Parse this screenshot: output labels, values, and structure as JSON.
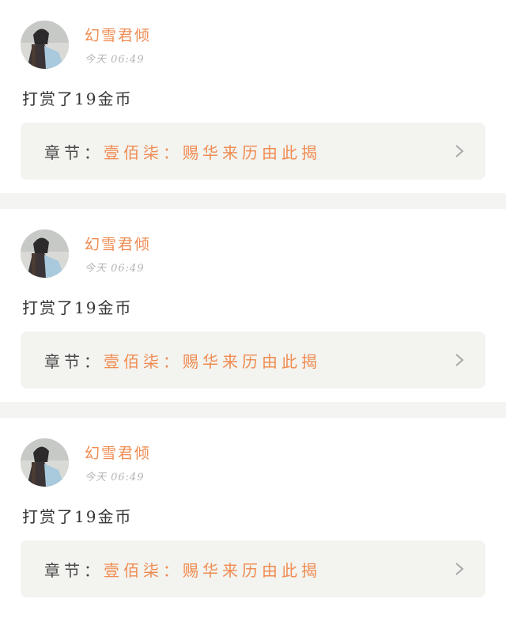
{
  "feed": [
    {
      "username": "幻雪君倾",
      "timestamp": "今天 06:49",
      "message": "打赏了19金币",
      "chapter_prefix": "章节：",
      "chapter_title": "壹佰柒：赐华来历由此揭"
    },
    {
      "username": "幻雪君倾",
      "timestamp": "今天 06:49",
      "message": "打赏了19金币",
      "chapter_prefix": "章节：",
      "chapter_title": "壹佰柒：赐华来历由此揭"
    },
    {
      "username": "幻雪君倾",
      "timestamp": "今天 06:49",
      "message": "打赏了19金币",
      "chapter_prefix": "章节：",
      "chapter_title": "壹佰柒：赐华来历由此揭"
    }
  ],
  "colors": {
    "accent": "#ef8c52",
    "text": "#333333",
    "muted": "#b3b3b3",
    "chapter_bg": "#f3f3ef",
    "separator": "#f4f4f2"
  },
  "icons": {
    "avatar": "user-avatar-image",
    "chevron": "chevron-right-icon"
  }
}
